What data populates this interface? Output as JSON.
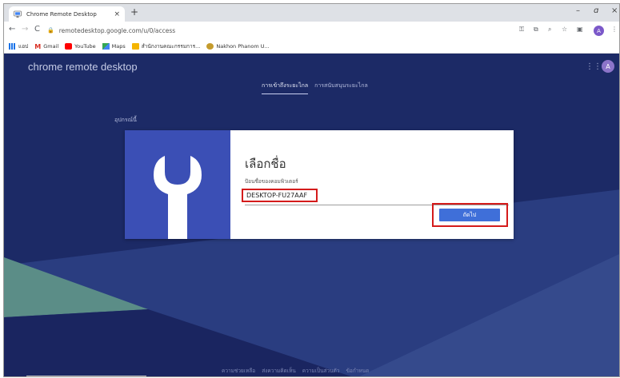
{
  "browser": {
    "tab_title": "Chrome Remote Desktop",
    "tab_close": "×",
    "new_tab": "+",
    "window_controls": {
      "minimize": "–",
      "restore": "ɑ",
      "close": "×"
    },
    "url": "remotedesktop.google.com/u/0/access",
    "profile_initial": "A",
    "bookmarks": [
      {
        "label": "แอป",
        "icon": "apps-icon",
        "color": "#1a73e8"
      },
      {
        "label": "Gmail",
        "icon": "gmail-icon",
        "color": "#d93025"
      },
      {
        "label": "YouTube",
        "icon": "youtube-icon",
        "color": "#ff0000"
      },
      {
        "label": "Maps",
        "icon": "maps-icon",
        "color": "#34a853"
      },
      {
        "label": "สำนักงานคณะกรรมการ...",
        "icon": "folder-icon",
        "color": "#f4b400"
      },
      {
        "label": "Nakhon Phanom U...",
        "icon": "university-icon",
        "color": "#c49b2d"
      }
    ]
  },
  "page": {
    "app_title": "chrome remote desktop",
    "profile_initial": "A",
    "tabs": [
      {
        "label": "การเข้าถึงระยะไกล",
        "active": true
      },
      {
        "label": "การสนับสนุนระยะไกล",
        "active": false
      }
    ],
    "section_label": "อุปกรณ์นี้",
    "dialog": {
      "title": "เลือกชื่อ",
      "field_label": "ป้อนชื่อของคอมพิวเตอร์",
      "field_value": "DESKTOP-FU27AAF",
      "next_button": "ถัดไป"
    },
    "footer_links": [
      "ความช่วยเหลือ",
      "ส่งความคิดเห็น",
      "ความเป็นส่วนตัว",
      "ข้อกำหนด"
    ]
  },
  "colors": {
    "page_bg": "#1c2a66",
    "dialog_icon_panel": "#3b4fb5",
    "button": "#3f6fd9",
    "highlight_box": "#d41b1b"
  }
}
